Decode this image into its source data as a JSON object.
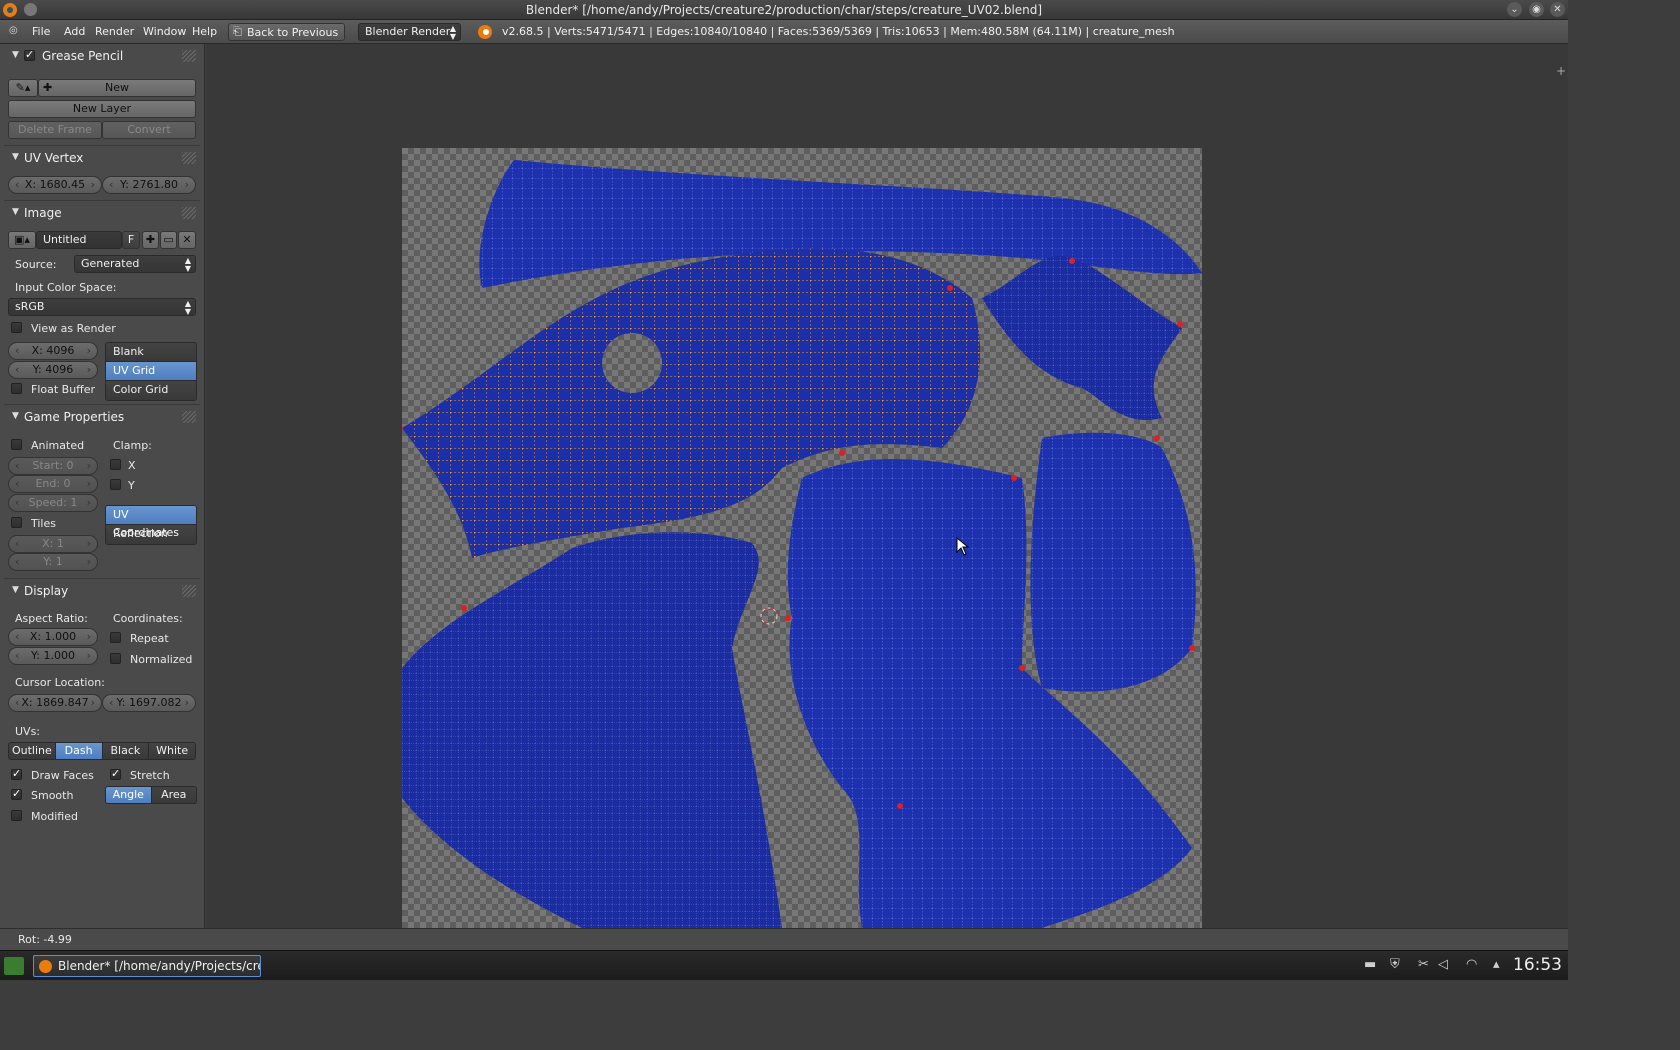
{
  "window": {
    "title": "Blender* [/home/andy/Projects/creature2/production/char/steps/creature_UV02.blend]",
    "controls": [
      "⌄",
      "◉",
      "✕"
    ]
  },
  "menubar": {
    "items": [
      "File",
      "Add",
      "Render",
      "Window",
      "Help"
    ],
    "back_label": "Back to Previous",
    "render_engine": "Blender Render",
    "stats": "v2.68.5 | Verts:5471/5471 | Edges:10840/10840 | Faces:5369/5369 | Tris:10653 | Mem:480.58M (64.11M) | creature_mesh"
  },
  "panel": {
    "grease_pencil": {
      "title": "Grease Pencil",
      "new_label": "New",
      "new_layer_label": "New Layer",
      "delete_frame_label": "Delete Frame",
      "convert_label": "Convert"
    },
    "uv_vertex": {
      "title": "UV Vertex",
      "x": "X: 1680.45",
      "y": "Y: 2761.80"
    },
    "image": {
      "title": "Image",
      "name": "Untitled",
      "fake_user": "F",
      "source_label": "Source:",
      "source_value": "Generated",
      "color_space_label": "Input Color Space:",
      "color_space_value": "sRGB",
      "view_as_render": "View as Render",
      "width": "X: 4096",
      "height": "Y: 4096",
      "float_buffer": "Float Buffer",
      "types": [
        "Blank",
        "UV Grid",
        "Color Grid"
      ],
      "active_type": "UV Grid"
    },
    "game_properties": {
      "title": "Game Properties",
      "animated": "Animated",
      "start": "Start: 0",
      "end": "End: 0",
      "speed": "Speed: 1",
      "tiles": "Tiles",
      "tile_x": "X: 1",
      "tile_y": "Y: 1",
      "clamp_label": "Clamp:",
      "clamp_x": "X",
      "clamp_y": "Y",
      "mapping": [
        "UV Coordinates",
        "Reflection"
      ],
      "active_mapping": "UV Coordinates"
    },
    "display": {
      "title": "Display",
      "aspect_label": "Aspect Ratio:",
      "aspect_x": "X: 1.000",
      "aspect_y": "Y: 1.000",
      "coords_label": "Coordinates:",
      "repeat": "Repeat",
      "normalized": "Normalized",
      "cursor_label": "Cursor Location:",
      "cursor_x": "X: 1869.847",
      "cursor_y": "Y: 1697.082",
      "uvs_label": "UVs:",
      "uv_styles": [
        "Outline",
        "Dash",
        "Black",
        "White"
      ],
      "active_uv_style": "Dash",
      "draw_faces": "Draw Faces",
      "stretch": "Stretch",
      "smooth": "Smooth",
      "stretch_modes": [
        "Angle",
        "Area"
      ],
      "active_stretch_mode": "Angle",
      "modified": "Modified"
    }
  },
  "status": {
    "rot": "Rot: -4.99"
  },
  "taskbar": {
    "task_label": "Blender* [/home/andy/Projects/cre",
    "clock": "16:53"
  },
  "colors": {
    "uv_island": "#1a2fa8",
    "uv_selected_vertex": "#ff9a1a",
    "uv_pinned": "#e02020",
    "accent": "#5b8bcf"
  }
}
